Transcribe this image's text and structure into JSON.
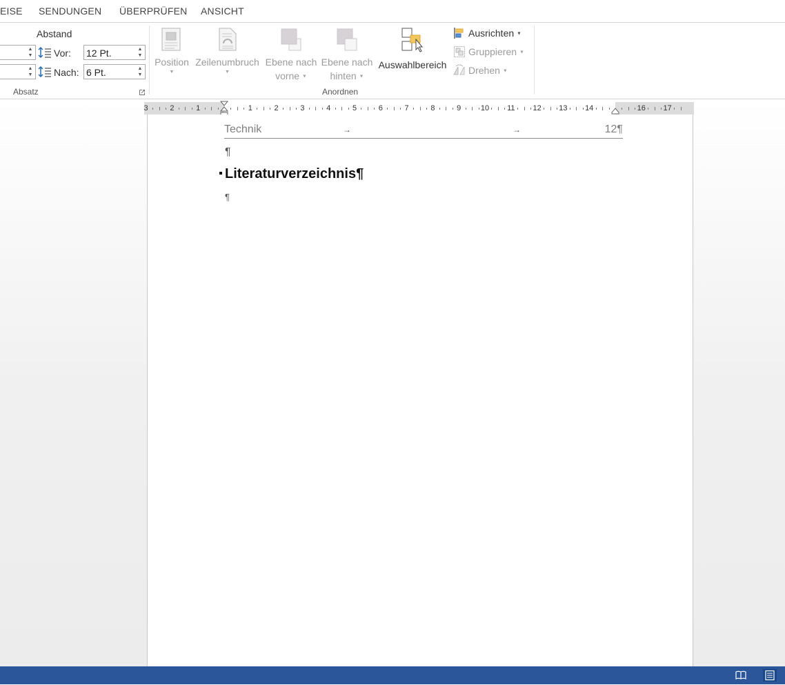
{
  "tabs": [
    "EISE",
    "SENDUNGEN",
    "ÜBERPRÜFEN",
    "ANSICHT"
  ],
  "absatz": {
    "abstand_label": "Abstand",
    "vor_label": "Vor:",
    "vor_value": "12 Pt.",
    "nach_label": "Nach:",
    "nach_value": "6 Pt.",
    "group_label": "Absatz"
  },
  "anordnen": {
    "position_label": "Position",
    "zeilenumbruch_label": "Zeilenumbruch",
    "ebene_vorne_line1": "Ebene nach",
    "ebene_vorne_line2": "vorne",
    "ebene_hinten_line1": "Ebene nach",
    "ebene_hinten_line2": "hinten",
    "auswahlbereich_label": "Auswahlbereich",
    "ausrichten_label": "Ausrichten",
    "gruppieren_label": "Gruppieren",
    "drehen_label": "Drehen",
    "group_label": "Anordnen"
  },
  "ruler": {
    "numbers": [
      "3",
      "2",
      "1",
      "1",
      "2",
      "3",
      "4",
      "5",
      "6",
      "7",
      "8",
      "9",
      "10",
      "11",
      "12",
      "13",
      "14",
      "16",
      "17"
    ]
  },
  "document": {
    "toc_entry_text": "Technik",
    "toc_tab_arrow": "→",
    "toc_entry_page": "12¶",
    "pilcrow": "¶",
    "heading": "Literaturverzeichnis¶"
  },
  "colors": {
    "statusbar": "#2b579a",
    "accent_yellow": "#f2c75c"
  }
}
